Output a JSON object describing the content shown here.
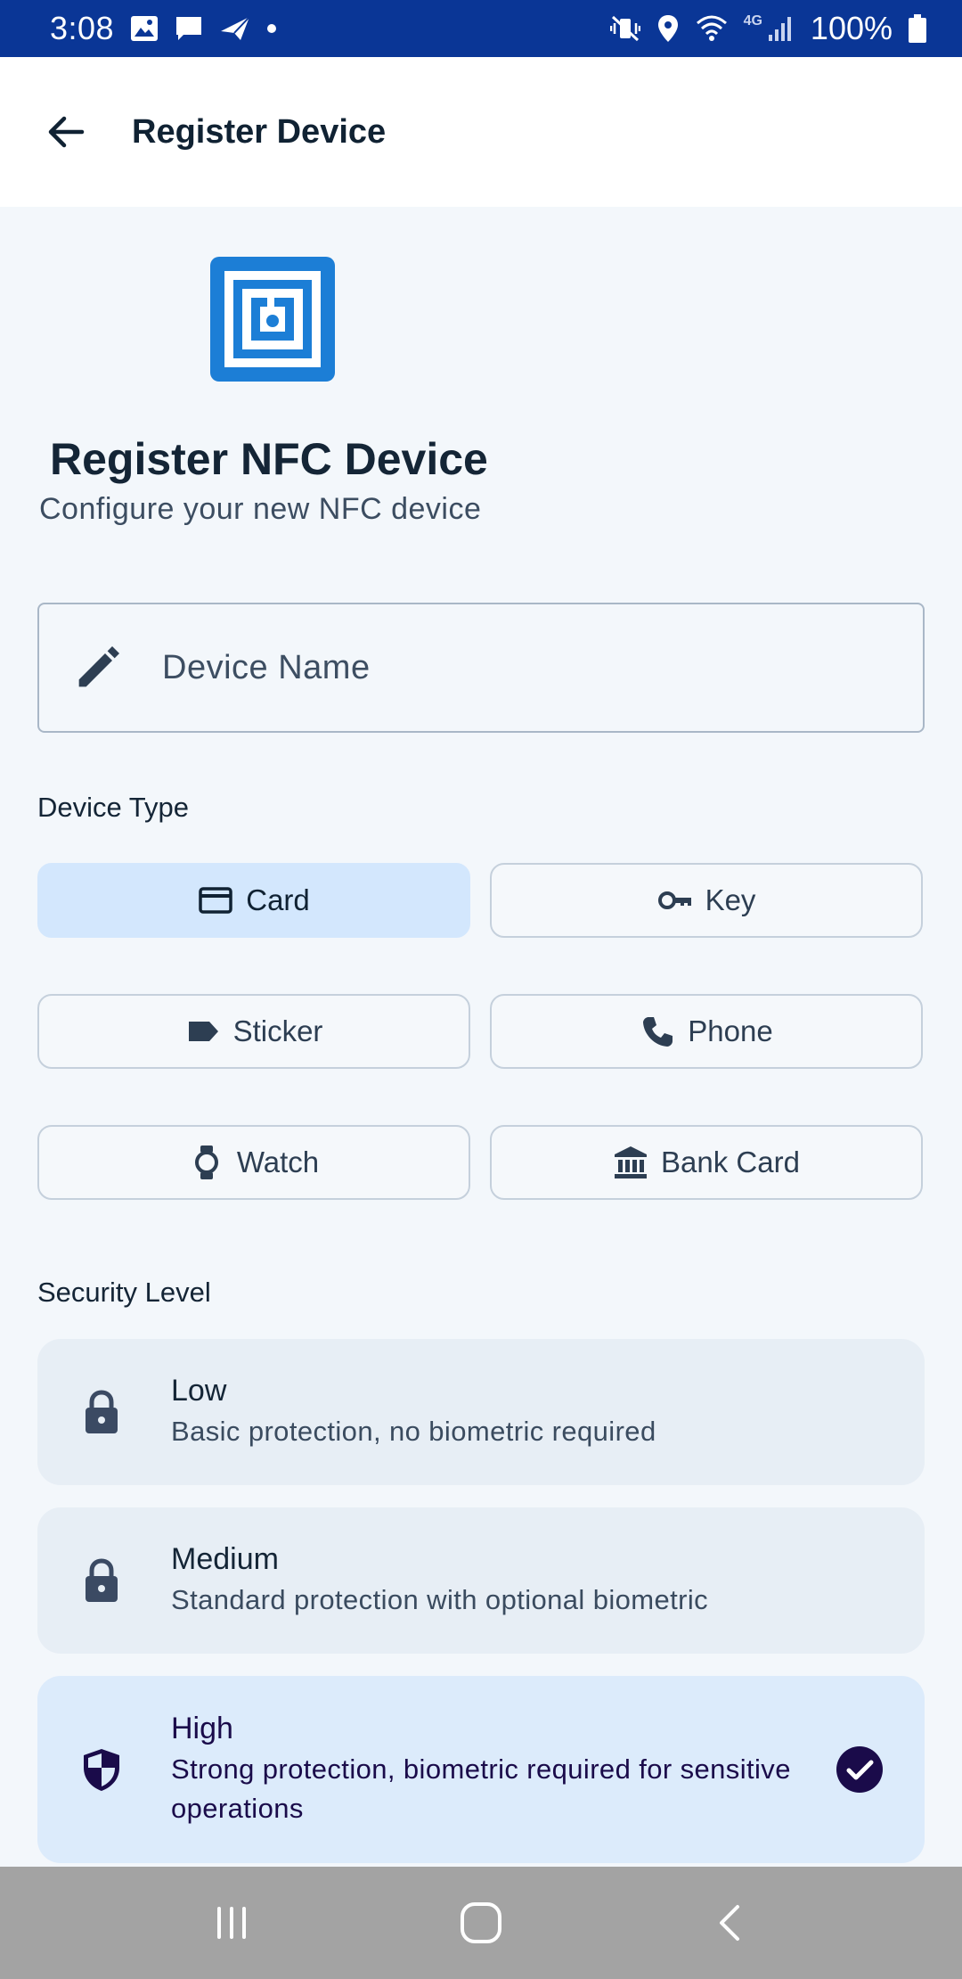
{
  "status_bar": {
    "time": "3:08",
    "network": "4G",
    "battery": "100%"
  },
  "app_bar": {
    "title": "Register Device"
  },
  "hero": {
    "title": "Register NFC Device",
    "subtitle": "Configure your new NFC device"
  },
  "device_name": {
    "placeholder": "Device Name",
    "value": ""
  },
  "device_type": {
    "label": "Device Type",
    "options": [
      {
        "label": "Card",
        "icon": "credit-card-icon",
        "selected": true
      },
      {
        "label": "Key",
        "icon": "key-icon",
        "selected": false
      },
      {
        "label": "Sticker",
        "icon": "label-icon",
        "selected": false
      },
      {
        "label": "Phone",
        "icon": "phone-icon",
        "selected": false
      },
      {
        "label": "Watch",
        "icon": "watch-icon",
        "selected": false
      },
      {
        "label": "Bank Card",
        "icon": "bank-icon",
        "selected": false
      }
    ]
  },
  "security_level": {
    "label": "Security Level",
    "options": [
      {
        "name": "Low",
        "description": "Basic protection, no biometric required",
        "icon": "lock-icon",
        "selected": false
      },
      {
        "name": "Medium",
        "description": "Standard protection with optional biometric",
        "icon": "lock-icon",
        "selected": false
      },
      {
        "name": "High",
        "description": "Strong protection, biometric required for sensitive operations",
        "icon": "shield-icon",
        "selected": true
      }
    ]
  },
  "colors": {
    "status_bar": "#0a3696",
    "primary": "#1c7ed6",
    "selected_chip": "#d3e7fd",
    "selected_check": "#1a0b4a",
    "nav_bar": "#a3a3a3"
  }
}
